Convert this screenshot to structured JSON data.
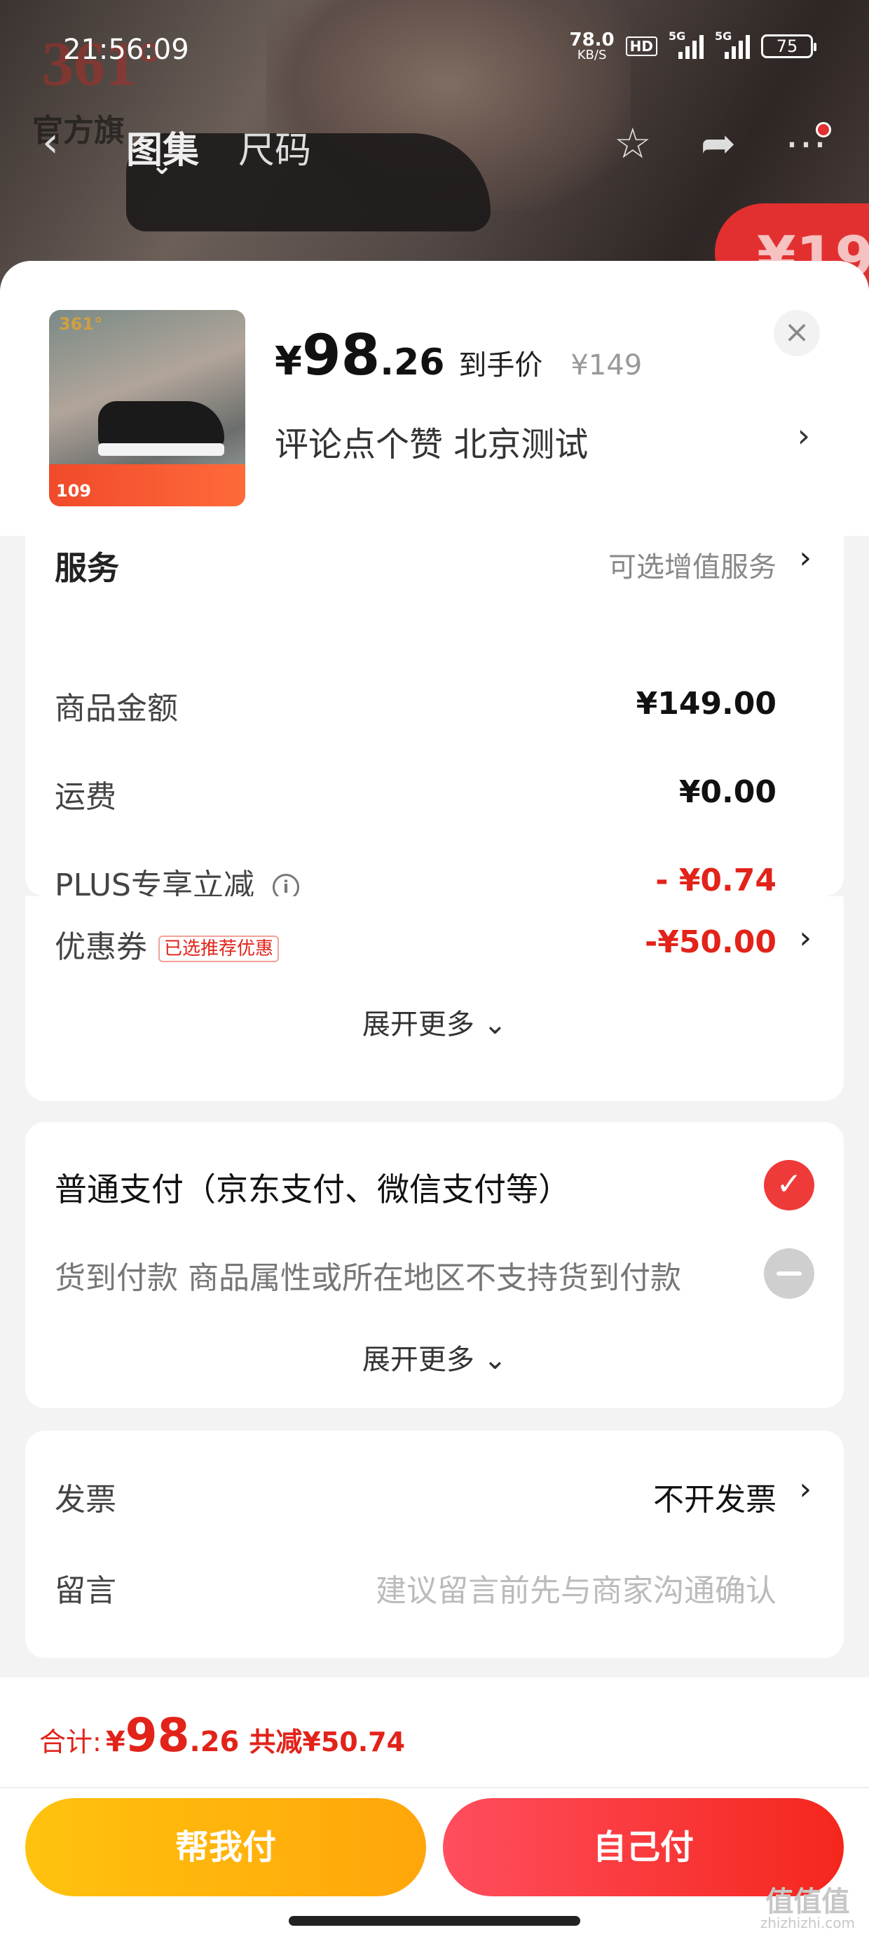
{
  "status_bar": {
    "time": "21:56:09",
    "speed_value": "78.0",
    "speed_unit": "KB/S",
    "hd_label": "HD",
    "signal1_label": "5G",
    "signal2_label": "5G",
    "battery": "75"
  },
  "nav": {
    "back_icon": "chevron-left-icon",
    "tabs": [
      {
        "label": "图集"
      },
      {
        "label": "尺码"
      }
    ],
    "brand_text": "361°",
    "brand_sub": "官方旗"
  },
  "hero": {
    "badge_text": "¥19"
  },
  "product": {
    "price_yen": "¥",
    "price_int": "98",
    "price_dec": ".26",
    "price_tag": "到手价",
    "original_price": "¥149",
    "spec": "评论点个赞  北京测试",
    "thumb_brand": "361°",
    "thumb_price": "109",
    "close_icon": "close-icon"
  },
  "service": {
    "label": "服务",
    "value": "可选增值服务"
  },
  "amounts": {
    "rows": [
      {
        "label": "商品金额",
        "value": "¥149.00"
      },
      {
        "label": "运费",
        "value": "¥0.00"
      },
      {
        "label": "PLUS专享立减",
        "value": "- ¥0.74"
      },
      {
        "label": "优惠券",
        "value": "-¥50.00",
        "tag": "已选推荐优惠"
      }
    ],
    "expand": "展开更多"
  },
  "payment": {
    "options": [
      {
        "label": "普通支付（京东支付、微信支付等）",
        "selected": true
      },
      {
        "label": "货到付款 商品属性或所在地区不支持货到付款",
        "selected": false
      }
    ],
    "expand": "展开更多"
  },
  "extra": {
    "invoice_label": "发票",
    "invoice_value": "不开发票",
    "message_label": "留言",
    "message_placeholder": "建议留言前先与商家沟通确认"
  },
  "footer": {
    "total_label": "合计:",
    "total_yen": "¥",
    "total_int": "98",
    "total_dec": ".26",
    "total_save": "共减¥50.74",
    "btn_help": "帮我付",
    "btn_self": "自己付",
    "watermark": "值值值",
    "watermark_sub": "zhizhizhi.com"
  },
  "colors": {
    "accent_red": "#e2231a",
    "btn_yellow": "#ffb30e",
    "btn_red": "#f5261c"
  }
}
